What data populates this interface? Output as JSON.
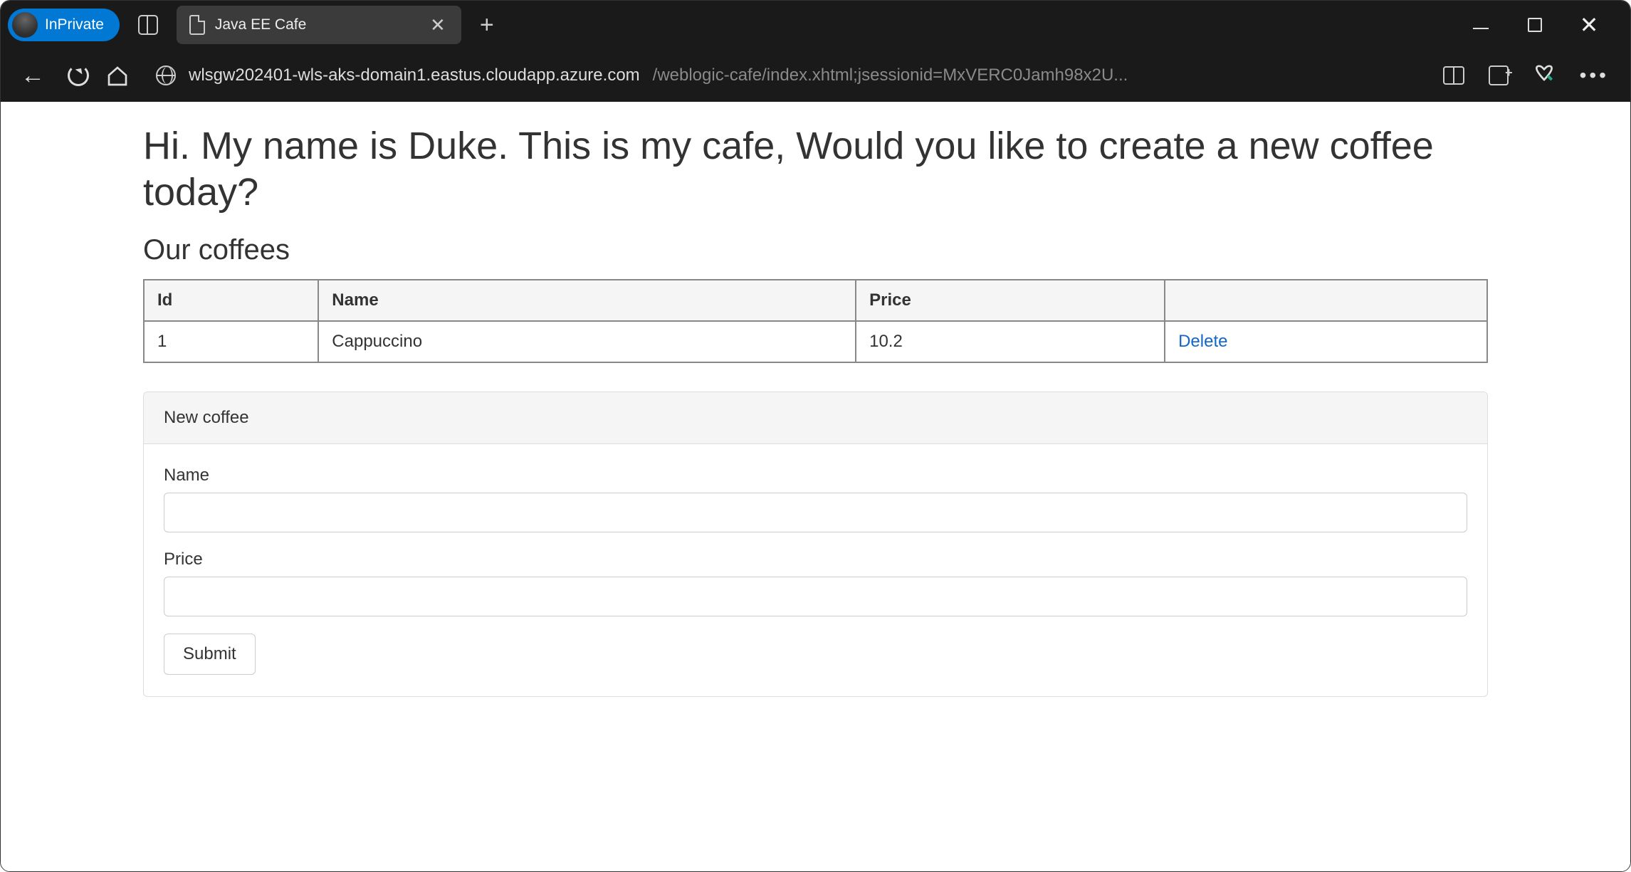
{
  "browser": {
    "inprivate_label": "InPrivate",
    "tab_title": "Java EE Cafe",
    "url_host": "wlsgw202401-wls-aks-domain1.eastus.cloudapp.azure.com",
    "url_path": "/weblogic-cafe/index.xhtml;jsessionid=MxVERC0Jamh98x2U..."
  },
  "page": {
    "heading": "Hi. My name is Duke. This is my cafe, Would you like to create a new coffee today?",
    "subheading": "Our coffees",
    "table": {
      "headers": {
        "id": "Id",
        "name": "Name",
        "price": "Price",
        "action": ""
      },
      "rows": [
        {
          "id": "1",
          "name": "Cappuccino",
          "price": "10.2",
          "action": "Delete"
        }
      ]
    },
    "form": {
      "panel_title": "New coffee",
      "name_label": "Name",
      "name_value": "",
      "price_label": "Price",
      "price_value": "",
      "submit_label": "Submit"
    }
  }
}
